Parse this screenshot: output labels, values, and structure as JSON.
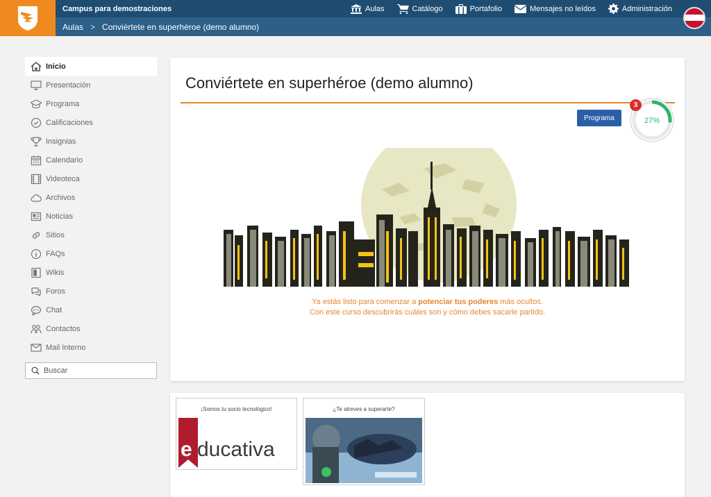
{
  "header": {
    "campus": "Campus para demostraciones",
    "nav": [
      {
        "label": "Aulas",
        "icon": "bank-icon"
      },
      {
        "label": "Catálogo",
        "icon": "cart-icon"
      },
      {
        "label": "Portafolio",
        "icon": "briefcase-icon"
      },
      {
        "label": "Mensajes no leídos",
        "icon": "envelope-icon"
      },
      {
        "label": "Administración",
        "icon": "gear-icon"
      }
    ],
    "breadcrumb": [
      "Aulas",
      "Conviértete en superhéroe (demo alumno)"
    ],
    "colors": {
      "brand": "#ef8a1f",
      "bar": "#2d5f87",
      "bar_dark": "#1f4d72"
    }
  },
  "sidebar": {
    "items": [
      {
        "label": "Inicio",
        "icon": "home-icon",
        "active": true
      },
      {
        "label": "Presentación",
        "icon": "monitor-icon"
      },
      {
        "label": "Programa",
        "icon": "graduation-cap-icon"
      },
      {
        "label": "Calificaciones",
        "icon": "check-circle-icon"
      },
      {
        "label": "Insignias",
        "icon": "trophy-icon"
      },
      {
        "label": "Calendario",
        "icon": "calendar-icon"
      },
      {
        "label": "Videoteca",
        "icon": "film-icon"
      },
      {
        "label": "Archivos",
        "icon": "cloud-icon"
      },
      {
        "label": "Noticias",
        "icon": "newspaper-icon"
      },
      {
        "label": "Sitios",
        "icon": "link-icon"
      },
      {
        "label": "FAQs",
        "icon": "info-icon"
      },
      {
        "label": "Wikis",
        "icon": "book-icon"
      },
      {
        "label": "Foros",
        "icon": "chat-bubbles-icon"
      },
      {
        "label": "Chat",
        "icon": "chat-icon"
      },
      {
        "label": "Contactos",
        "icon": "people-icon"
      },
      {
        "label": "Mail Interno",
        "icon": "mail-icon"
      }
    ],
    "search_label": "Buscar"
  },
  "course": {
    "title": "Conviértete en superhéroe (demo alumno)",
    "button": "Programa",
    "badge": "3",
    "progress": 27,
    "progress_text": "27%",
    "message_line1_pre": "Ya estás listo para comenzar a ",
    "message_line1_bold": "potenciar tus poderes",
    "message_line1_post": " más ocultos.",
    "message_line2": "Con este curso descubrirás cuáles son y cómo debes sacarle partido.",
    "accent": "#e8842c"
  },
  "tiles": [
    {
      "caption": "¡Somos tu socio tecnológico!",
      "logo_text": "educativa"
    },
    {
      "caption": "¿Te atreves a superarte?"
    }
  ]
}
